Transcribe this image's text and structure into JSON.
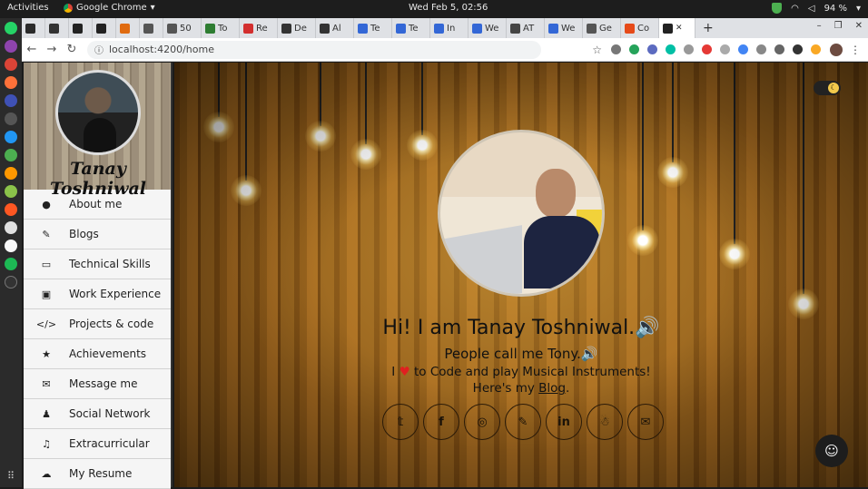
{
  "topbar": {
    "activities": "Activities",
    "app": "Google Chrome",
    "clock": "Wed Feb  5, 02:56",
    "battery": "94 %"
  },
  "tabs": [
    {
      "label": "",
      "color": "#2b2b2b"
    },
    {
      "label": "",
      "color": "#333"
    },
    {
      "label": "",
      "color": "#222"
    },
    {
      "label": "",
      "color": "#222"
    },
    {
      "label": "",
      "color": "#e06b10"
    },
    {
      "label": "",
      "color": "#555"
    },
    {
      "label": "50",
      "color": "#555"
    },
    {
      "label": "To",
      "color": "#2e7d32"
    },
    {
      "label": "Re",
      "color": "#d32f2f"
    },
    {
      "label": "De",
      "color": "#333"
    },
    {
      "label": "Al",
      "color": "#333"
    },
    {
      "label": "Te",
      "color": "#3367d6"
    },
    {
      "label": "Te",
      "color": "#3367d6"
    },
    {
      "label": "In",
      "color": "#3367d6"
    },
    {
      "label": "We",
      "color": "#3367d6"
    },
    {
      "label": "AT",
      "color": "#444"
    },
    {
      "label": "We",
      "color": "#3367d6"
    },
    {
      "label": "Ge",
      "color": "#555"
    },
    {
      "label": "Co",
      "color": "#e64a19"
    },
    {
      "label": "",
      "color": "#222",
      "active": true
    }
  ],
  "nav": {
    "url": "localhost:4200/home"
  },
  "sidebar": {
    "name": "Tanay Toshniwal",
    "items": [
      {
        "icon": "●",
        "label": "About me"
      },
      {
        "icon": "✎",
        "label": "Blogs"
      },
      {
        "icon": "▭",
        "label": "Technical Skills"
      },
      {
        "icon": "▣",
        "label": "Work Experience"
      },
      {
        "icon": "</>",
        "label": "Projects & code"
      },
      {
        "icon": "★",
        "label": "Achievements"
      },
      {
        "icon": "✉",
        "label": "Message me"
      },
      {
        "icon": "♟",
        "label": "Social Network"
      },
      {
        "icon": "♫",
        "label": "Extracurricular"
      },
      {
        "icon": "☁",
        "label": "My Resume"
      }
    ]
  },
  "hero": {
    "greeting": "Hi! I am Tanay Toshniwal.🔊",
    "nickname": "People call me Tony.🔊",
    "love_prefix": "I",
    "love_suffix": "to Code and play Musical Instruments!",
    "blog_prefix": "Here's my",
    "blog_link": "Blog",
    "blog_suffix": "."
  },
  "socials": [
    {
      "icon": "twitter-icon",
      "glyph": "𝕥"
    },
    {
      "icon": "facebook-icon",
      "glyph": "f"
    },
    {
      "icon": "github-icon",
      "glyph": "◎"
    },
    {
      "icon": "blog-pen-icon",
      "glyph": "✎"
    },
    {
      "icon": "linkedin-icon",
      "glyph": "in"
    },
    {
      "icon": "hackerearth-icon",
      "glyph": "☃"
    },
    {
      "icon": "email-icon",
      "glyph": "✉"
    }
  ]
}
